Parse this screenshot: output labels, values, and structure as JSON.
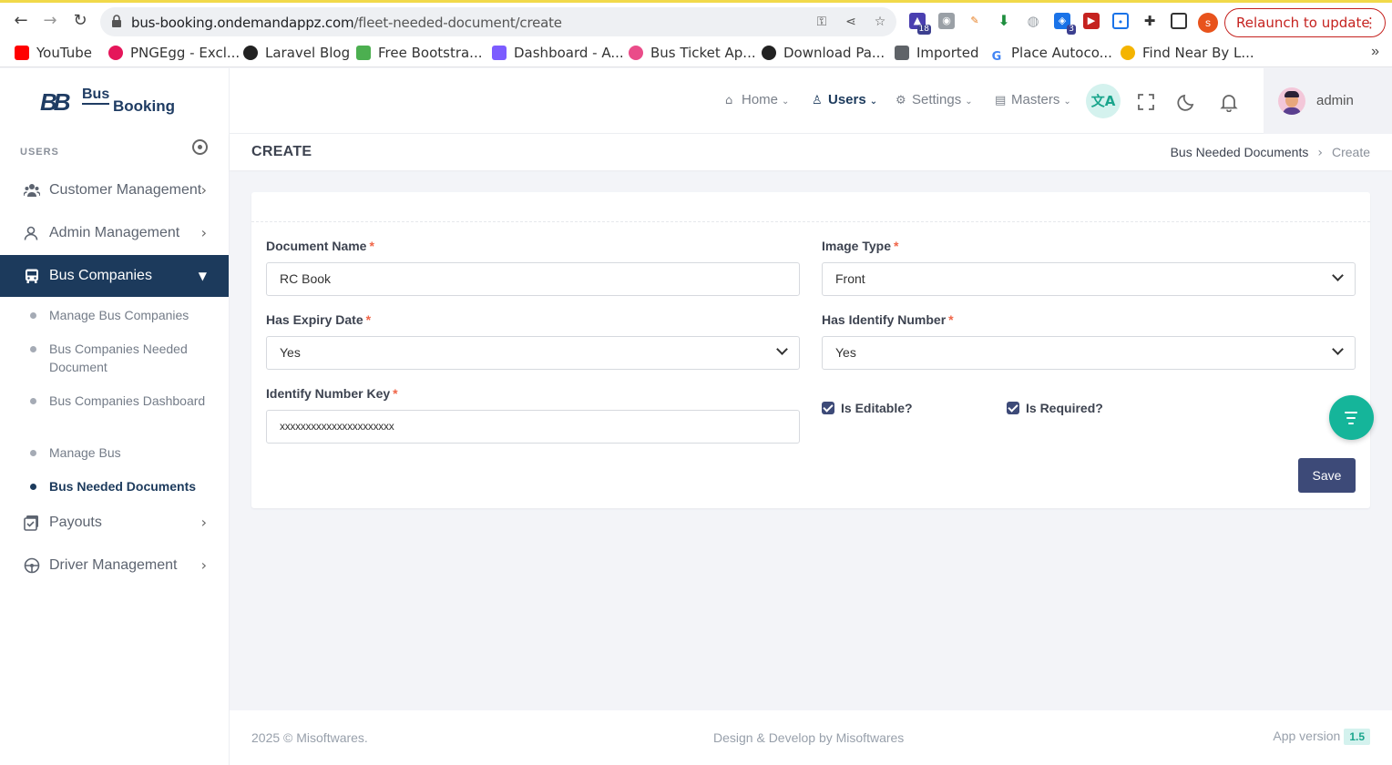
{
  "browser": {
    "url_domain": "bus-booking.ondemandappz.com",
    "url_path": "/fleet-needed-document/create",
    "profile_initial": "s",
    "relaunch_label": "Relaunch to update",
    "ext_badge_1": "18",
    "ext_badge_2": "3",
    "bookmarks": [
      "YouTube",
      "PNGEgg - Excl...",
      "Laravel Blog",
      "Free Bootstra...",
      "Dashboard - A...",
      "Bus Ticket Ap...",
      "Download Pa...",
      "Imported",
      "Place Autoco...",
      "Find Near By L..."
    ],
    "bookmarks_more": "»"
  },
  "sidebar": {
    "logo": {
      "mark": "BB",
      "word1": "Bus",
      "word2": "Booking"
    },
    "section_title": "USERS",
    "items": [
      {
        "label": "Customer Management"
      },
      {
        "label": "Admin Management"
      },
      {
        "label": "Bus Companies"
      },
      {
        "label": "Payouts"
      },
      {
        "label": "Driver Management"
      }
    ],
    "subitems": [
      {
        "label": "Manage Bus Companies"
      },
      {
        "label": "Bus Companies Needed Document"
      },
      {
        "label": "Bus Companies Dashboard"
      },
      {
        "label": "Manage Bus"
      },
      {
        "label": "Bus Needed Documents"
      }
    ]
  },
  "topnav": {
    "items": [
      {
        "label": "Home"
      },
      {
        "label": "Users"
      },
      {
        "label": "Settings"
      },
      {
        "label": "Masters"
      }
    ],
    "lang_icon": "文A",
    "username": "admin"
  },
  "page": {
    "title": "CREATE",
    "breadcrumb": [
      "Bus Needed Documents",
      "Create"
    ]
  },
  "form": {
    "document_name_label": "Document Name",
    "document_name_value": "RC Book",
    "image_type_label": "Image Type",
    "image_type_value": "Front",
    "has_expiry_label": "Has Expiry Date",
    "has_expiry_value": "Yes",
    "has_identify_label": "Has Identify Number",
    "has_identify_value": "Yes",
    "identify_key_label": "Identify Number Key",
    "identify_key_value": "xxxxxxxxxxxxxxxxxxxxxx",
    "is_editable_label": "Is Editable?",
    "is_editable_checked": true,
    "is_required_label": "Is Required?",
    "is_required_checked": true,
    "required_mark": "*",
    "save_label": "Save"
  },
  "footer": {
    "copyright": "2025 © Misoftwares.",
    "credit": "Design & Develop by Misoftwares",
    "version_label": "App version",
    "version_value": "1.5"
  },
  "colors": {
    "primary": "#1c3a5c",
    "button": "#3d4a78",
    "accent": "#15b59a",
    "required": "#f06548"
  }
}
